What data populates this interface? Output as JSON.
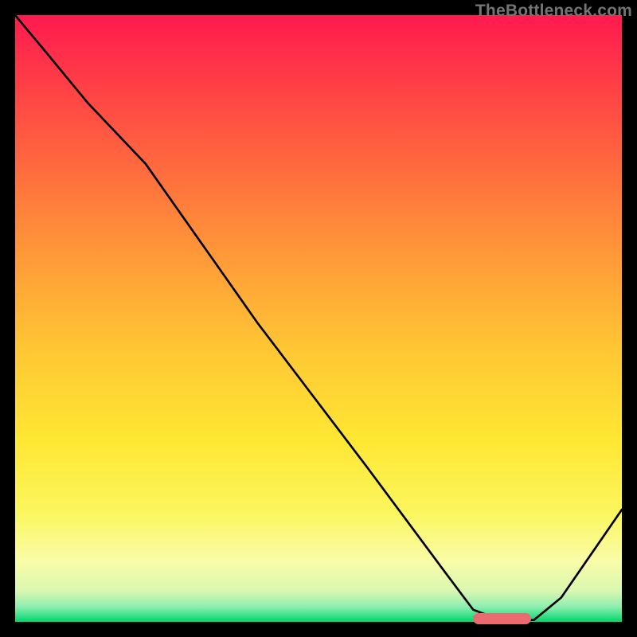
{
  "watermark": "TheBottleneck.com",
  "chart_data": {
    "type": "line",
    "title": "",
    "xlabel": "",
    "ylabel": "",
    "xlim": [
      0,
      100
    ],
    "ylim": [
      0,
      100
    ],
    "background_gradient_top": "#ff1a4f",
    "background_gradient_mid_upper": "#ff8f3a",
    "background_gradient_mid_lower": "#ffe63a",
    "background_gradient_low": "#fcfca0",
    "background_gradient_bottom": "#00d66b",
    "series": [
      {
        "name": "bottleneck-curve",
        "color": "#000000",
        "x": [
          0,
          5,
          12,
          21.5,
          40,
          58,
          71,
          75.5,
          80,
          85.5,
          90,
          100
        ],
        "values": [
          100,
          94,
          85.5,
          75.5,
          49.2,
          25.5,
          8.0,
          2.0,
          0.3,
          0.3,
          4.0,
          18.5
        ]
      }
    ],
    "marker": {
      "name": "optimal-range-marker",
      "color": "#e96a6f",
      "x_start": 75.5,
      "x_end": 85.0,
      "y": 0.5,
      "thickness": 1.8
    }
  }
}
